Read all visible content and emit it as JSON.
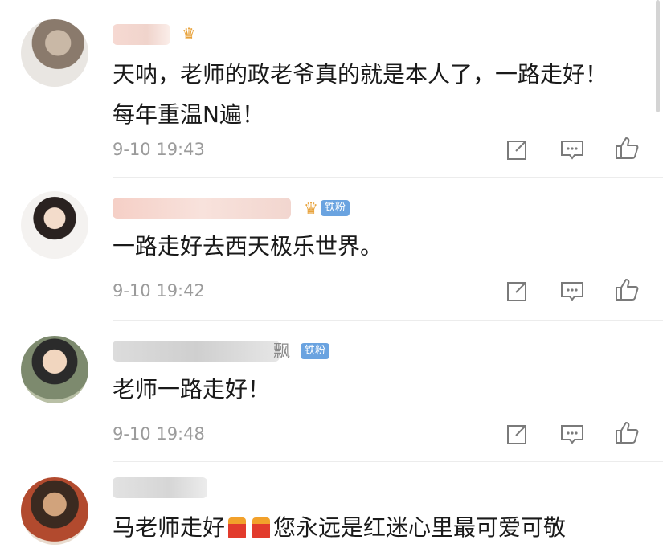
{
  "comments": [
    {
      "name_visible": "",
      "text": "天呐，老师的政老爷真的就是本人了，一路走好！每年重温N遍！",
      "time": "9-10 19:43",
      "badge": ""
    },
    {
      "name_visible": "",
      "text": "一路走好去西天极乐世界。",
      "time": "9-10 19:42",
      "badge": "铁粉"
    },
    {
      "name_visible": "飘",
      "text": "老师一路走好！",
      "time": "9-10 19:48",
      "badge": "铁粉"
    },
    {
      "name_visible": "",
      "text_part1": "马老师走好",
      "text_part2": "您永远是红迷心里最可爱可敬",
      "time": "",
      "badge": ""
    }
  ],
  "icons": {
    "share": "share-icon",
    "comment": "comment-icon",
    "like": "like-icon"
  },
  "colors": {
    "text": "#1a1a1a",
    "time": "#9b9b9b",
    "badge": "#6aa3e0",
    "icon": "#7a7a7a"
  }
}
